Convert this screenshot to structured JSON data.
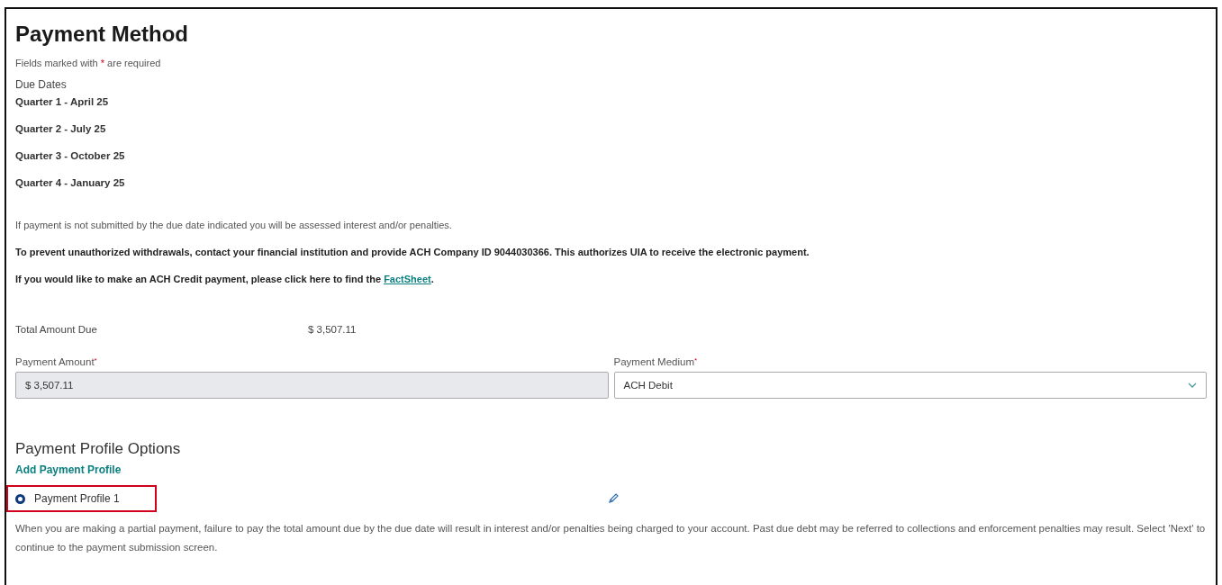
{
  "title": "Payment Method",
  "required_note": {
    "before": "Fields marked with",
    "mark": "*",
    "after": "are required"
  },
  "due_dates": {
    "label": "Due Dates",
    "items": [
      "Quarter 1 - April 25",
      "Quarter 2 - July 25",
      "Quarter 3 - October 25",
      "Quarter 4 - January 25"
    ]
  },
  "notices": [
    {
      "kind": "plain",
      "text": "If payment is not submitted by the due date indicated you will be assessed interest and/or penalties."
    },
    {
      "kind": "bold",
      "text": "To prevent unauthorized withdrawals, contact your financial institution and provide ACH Company ID 9044030366. This authorizes UIA to receive the electronic payment."
    },
    {
      "kind": "link",
      "text": "If you would like to make an ACH Credit payment, please click here to find the",
      "link": "FactSheet",
      "after": "."
    }
  ],
  "total": {
    "label": "Total Amount Due",
    "value": "$ 3,507.11"
  },
  "payment_amount": {
    "label": "Payment Amount",
    "mark": "*",
    "value": "$ 3,507.11",
    "disabled": true
  },
  "payment_medium": {
    "label": "Payment Medium",
    "mark": "*",
    "value": "ACH Debit"
  },
  "profiles": {
    "heading": "Payment Profile Options",
    "add_link": "Add Payment Profile",
    "items": [
      {
        "label": "Payment Profile 1",
        "selected": true,
        "highlighted": true
      }
    ]
  },
  "footnote": "When you are making a partial payment, failure to pay the total amount due by the due date will result in interest and/or penalties being charged to your account. Past due debt may be referred to collections and enforcement penalties may result. Select 'Next' to continue to the payment submission screen."
}
